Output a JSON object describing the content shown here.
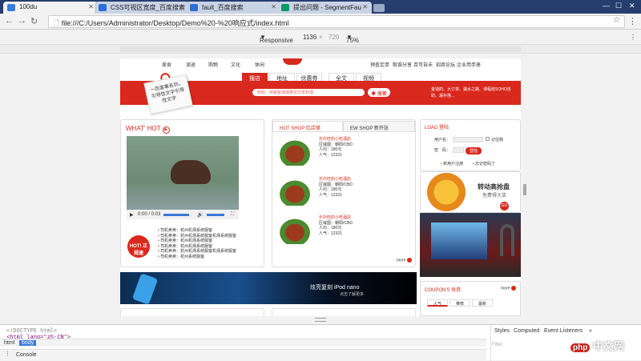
{
  "browser": {
    "tabs": [
      {
        "title": "100du",
        "favicon_color": "#3a7be0"
      },
      {
        "title": "CSS可视区宽度_百度搜索",
        "favicon_color": "#2b6fd6"
      },
      {
        "title": "fault_百度搜索",
        "favicon_color": "#2b6fd6"
      },
      {
        "title": "提出问题 - SegmentFau",
        "favicon_color": "#009a61"
      }
    ],
    "url": "file:///C:/Users/Administrator/Desktop/Demo%20-%20响应式/index.html",
    "device_toolbar": {
      "mode": "Responsive",
      "width": "1136",
      "times": "×",
      "height": "720",
      "zoom": "75%"
    }
  },
  "page": {
    "top_nav": [
      "美食",
      "读途",
      "购物",
      "文化",
      "休闲",
      "预查定单",
      "取谁分享",
      "百可自未",
      "招商论坛",
      "企业用手册"
    ],
    "sub_tabs": [
      "搜店",
      "地址",
      "优惠券",
      "全文",
      "视频"
    ],
    "search_placeholder": "例如：荷棠鱼馆或樱花日本料理",
    "search_button": "搜索",
    "right_links": "金钱的、大订单、漏水之路、课程结SOHO自助、漏补搭...",
    "note_text": "一百度事系列，引导性文字引导性文字",
    "whats_hot": "WHAT' HOT",
    "video_time": "0:00 / 0:03",
    "hot_badge": "HOT!\n正规速",
    "hot_list": [
      "司机卖卖：杭州机场系统服客",
      "司机卖卖：杭州机场系统服客机场系统服客",
      "司机卖卖：杭州机场系统服客",
      "司机卖卖：杭州机场系统服客",
      "司机卖卖：杭州机场系统服客机场系统服客",
      "司机卖卖：杭州系统服客"
    ],
    "product_tabs": [
      "HOT SHOP 红店铺",
      "EW SHOP 新开张"
    ],
    "products": [
      {
        "title": "乐扑旺的小吃酒店",
        "area": "区域图：朝阳/CBD",
        "price": "人均：180元",
        "views": "人气：12321"
      },
      {
        "title": "乐扑旺的小吃酒店",
        "area": "区域图：朝阳/CBD",
        "price": "人均：180元",
        "views": "人气：12321"
      },
      {
        "title": "乐扑旺的小吃酒店",
        "area": "区域图：朝阳/CBD",
        "price": "人均：180元",
        "views": "人气：12321"
      }
    ],
    "more": "more",
    "login_title": "LOAD 登陆",
    "username_label": "用户名：",
    "password_label": "密　码：",
    "remember": "记住我",
    "login_button": "登陆",
    "register": "新用户注册",
    "forgot": "忘记密码了",
    "wheel_title": "转动高抢盘",
    "wheel_sub": "免费得大奖",
    "go": "GO",
    "banner_title": "炫亮复刻  iPod nano",
    "banner_sub": "点击了解更多",
    "coupon_title": "COUPON'S 抢券",
    "coupon_tabs": [
      "人气",
      "推荐",
      "最新"
    ]
  },
  "devtools": {
    "code_lines": [
      "<!DOCTYPE html>",
      "<html lang=\"zh-CN\">"
    ],
    "crumbs": [
      "html",
      "body"
    ],
    "console": "Console",
    "right_tabs": [
      "Styles",
      "Computed",
      "Event Listeners",
      "»"
    ],
    "filter": "Filter"
  },
  "watermark": {
    "logo": "php",
    "text": "中文网"
  }
}
